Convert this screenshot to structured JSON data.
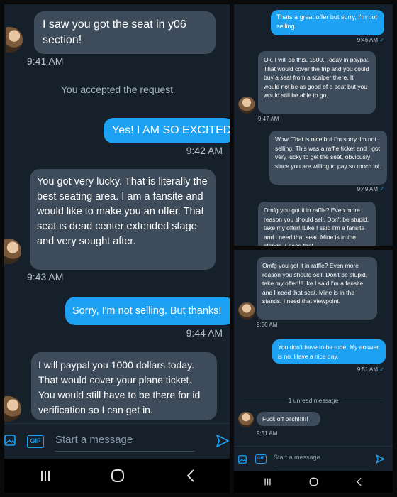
{
  "left": {
    "messages": [
      {
        "type": "in",
        "text": "I saw you got the seat in y06 section!",
        "time": "9:41 AM"
      },
      {
        "type": "system",
        "text": "You accepted the request"
      },
      {
        "type": "out",
        "text": "Yes! I AM SO EXCITED!!!!",
        "time": "9:42 AM"
      },
      {
        "type": "in",
        "text": "You got very lucky. That is literally the best seating area. I am a fansite and would like to make you an offer. That seat is dead center extended stage and very sought after.",
        "time": "9:43 AM"
      },
      {
        "type": "out",
        "text": "Sorry, I'm not selling. But thanks!",
        "time": "9:44 AM"
      },
      {
        "type": "in",
        "text": "I will paypal you 1000 dollars today. That would cover your plane ticket. You would still have to be there for id verification so I can get in."
      }
    ],
    "composer": {
      "placeholder": "Start a message",
      "gif_label": "GIF"
    }
  },
  "top_right": {
    "messages": [
      {
        "type": "out",
        "text": "Thats a great offer but sorry, I'm not selling.",
        "time": "9:46 AM",
        "check": "✓"
      },
      {
        "type": "in",
        "text": "Ok, I will do this.  1500. Today in paypal. That would cover the trip and you could buy a seat from a scalper there. It would not be as good of a seat but you would still be able to go.",
        "time": "9:47 AM"
      },
      {
        "type": "out",
        "text": "Wow.  That is nice but I'm sorry. Im not selling.  This was a raffle ticket and I got very lucky to get the seat, obviously since you are willing to pay so much lol.",
        "time": "9:49 AM",
        "check": "✓"
      },
      {
        "type": "in",
        "text": "Omfg you got it in raffle? Even more reason you should sell.  Don't be stupid, take my offer!!!Like I said I'm  a fansite and I need that seat. Mine is in the stands.  I need that"
      }
    ]
  },
  "bottom_right": {
    "messages": [
      {
        "type": "in",
        "text": "Omfg you got it in raffle? Even more reason you should sell.  Don't be stupid, take my offer!!!Like I said I'm  a fansite and I need that seat. Mine is in the stands.  I need that viewpoint.",
        "time": "9:50 AM"
      },
      {
        "type": "out",
        "text": "You don't have to be rude.  My answer is no. Have a nice day.",
        "time": "9:51 AM",
        "check": "✓"
      },
      {
        "type": "divider",
        "text": "1 unread message"
      },
      {
        "type": "in",
        "text": "Fuck off bitch!!!!!!",
        "time": "9:51 AM"
      }
    ],
    "composer": {
      "placeholder": "Start a message",
      "gif_label": "GIF"
    }
  },
  "icons": {
    "image": "image-icon",
    "gif": "gif-icon",
    "send": "send-icon",
    "recents": "recents-icon",
    "home": "home-icon",
    "back": "back-icon"
  },
  "colors": {
    "background": "#15202b",
    "incoming_bubble": "#3d4b5a",
    "outgoing_bubble": "#1da1f2",
    "accent": "#1da1f2"
  }
}
